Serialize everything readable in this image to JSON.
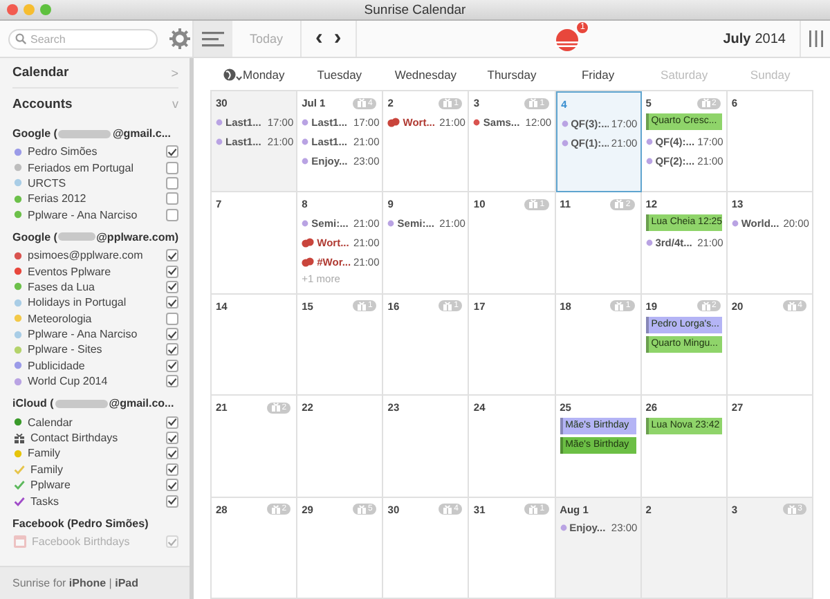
{
  "window": {
    "title": "Sunrise Calendar"
  },
  "toolbar": {
    "search": {
      "placeholder": "Search"
    },
    "today": "Today",
    "prev": "‹",
    "next": "›",
    "notification_count": "1",
    "month": "July",
    "year": "2014"
  },
  "sidebar": {
    "calendar_heading": "Calendar",
    "calendar_chevron": ">",
    "accounts_heading": "Accounts",
    "accounts_chevron": "v",
    "accounts": [
      {
        "prefix": "Google (",
        "suffix": "@gmail.c...",
        "items": [
          {
            "kind": "dot",
            "label": "Pedro Simões",
            "color": "#9b9be8",
            "checked": true
          },
          {
            "kind": "dot",
            "label": "Feriados em Portugal",
            "color": "#bdbdbd",
            "checked": false
          },
          {
            "kind": "dot",
            "label": "URCTS",
            "color": "#a9cde6",
            "checked": false
          },
          {
            "kind": "dot",
            "label": "Ferias 2012",
            "color": "#6cc04a",
            "checked": false
          },
          {
            "kind": "dot",
            "label": "Pplware - Ana Narciso",
            "color": "#6cc04a",
            "checked": false
          }
        ]
      },
      {
        "prefix": "Google (",
        "suffix": "@pplware.com)",
        "items": [
          {
            "kind": "dot",
            "label": "psimoes@pplware.com",
            "color": "#d9534f",
            "checked": true
          },
          {
            "kind": "dot",
            "label": "Eventos Pplware",
            "color": "#e8473c",
            "checked": true
          },
          {
            "kind": "dot",
            "label": "Fases da Lua",
            "color": "#6cc04a",
            "checked": true
          },
          {
            "kind": "dot",
            "label": "Holidays in Portugal",
            "color": "#a9cde6",
            "checked": true
          },
          {
            "kind": "dot",
            "label": "Meteorologia",
            "color": "#f3c948",
            "checked": false
          },
          {
            "kind": "dot",
            "label": "Pplware - Ana Narciso",
            "color": "#a9cde6",
            "checked": true
          },
          {
            "kind": "dot",
            "label": "Pplware - Sites",
            "color": "#b4d36b",
            "checked": true
          },
          {
            "kind": "dot",
            "label": "Publicidade",
            "color": "#9b9be8",
            "checked": true
          },
          {
            "kind": "dot",
            "label": "World Cup 2014",
            "color": "#b9a3e3",
            "checked": true
          }
        ]
      },
      {
        "prefix": "iCloud (",
        "suffix": "@gmail.co...",
        "items": [
          {
            "kind": "dot",
            "label": "Calendar",
            "color": "#3a9a2a",
            "checked": true
          },
          {
            "kind": "gift",
            "label": "Contact Birthdays",
            "checked": true
          },
          {
            "kind": "dot",
            "label": "Family",
            "color": "#e6c40a",
            "checked": true
          },
          {
            "kind": "tick",
            "label": "Family",
            "color": "#e6c44a",
            "checked": true
          },
          {
            "kind": "tick",
            "label": "Pplware",
            "color": "#5cb85c",
            "checked": true
          },
          {
            "kind": "tick",
            "label": "Tasks",
            "color": "#a04cc8",
            "checked": true
          }
        ]
      },
      {
        "title": "Facebook (Pedro Simões)",
        "items": [
          {
            "kind": "calendar",
            "label": "Facebook Birthdays",
            "checked": true,
            "disabled": true
          }
        ]
      }
    ],
    "footer": {
      "lead": "Sunrise for ",
      "first": "iPhone",
      "sep": " | ",
      "second": "iPad"
    }
  },
  "weekdays": [
    {
      "label": "Monday",
      "weekend": false
    },
    {
      "label": "Tuesday",
      "weekend": false
    },
    {
      "label": "Wednesday",
      "weekend": false
    },
    {
      "label": "Thursday",
      "weekend": false
    },
    {
      "label": "Friday",
      "weekend": false
    },
    {
      "label": "Saturday",
      "weekend": true
    },
    {
      "label": "Sunday",
      "weekend": true
    }
  ],
  "days": [
    {
      "label": "30",
      "outside": true,
      "selected": false,
      "events": [
        {
          "kind": "dot",
          "title": "Last1...",
          "time": "17:00",
          "color": "#b9a3e3"
        },
        {
          "kind": "dot",
          "title": "Last1...",
          "time": "21:00",
          "color": "#b9a3e3"
        }
      ]
    },
    {
      "label": "Jul 1",
      "outside": false,
      "selected": false,
      "badge": "4",
      "events": [
        {
          "kind": "dot",
          "title": "Last1...",
          "time": "17:00",
          "color": "#b9a3e3"
        },
        {
          "kind": "dot",
          "title": "Last1...",
          "time": "21:00",
          "color": "#b9a3e3"
        },
        {
          "kind": "dot",
          "title": "Enjoy...",
          "time": "23:00",
          "color": "#b9a3e3"
        }
      ]
    },
    {
      "label": "2",
      "outside": false,
      "selected": false,
      "badge": "1",
      "events": [
        {
          "kind": "social",
          "title": "Wort...",
          "time": "21:00",
          "color": "#c9453c"
        }
      ]
    },
    {
      "label": "3",
      "outside": false,
      "selected": false,
      "badge": "1",
      "events": [
        {
          "kind": "dot",
          "title": "Sams...",
          "time": "12:00",
          "color": "#d9534f"
        }
      ]
    },
    {
      "label": "4",
      "outside": false,
      "selected": true,
      "events": [
        {
          "kind": "dot",
          "title": "QF(3):...",
          "time": "17:00",
          "color": "#b9a3e3"
        },
        {
          "kind": "dot",
          "title": "QF(1):...",
          "time": "21:00",
          "color": "#b9a3e3"
        }
      ]
    },
    {
      "label": "5",
      "outside": false,
      "selected": false,
      "badge": "2",
      "events": [
        {
          "kind": "tile",
          "title": "Quarto Cresc...",
          "color": "#8fd46a"
        },
        {
          "kind": "dot",
          "title": "QF(4):...",
          "time": "17:00",
          "color": "#b9a3e3"
        },
        {
          "kind": "dot",
          "title": "QF(2):...",
          "time": "21:00",
          "color": "#b9a3e3"
        }
      ]
    },
    {
      "label": "6",
      "outside": false,
      "selected": false
    },
    {
      "label": "7",
      "outside": false,
      "selected": false
    },
    {
      "label": "8",
      "outside": false,
      "selected": false,
      "events": [
        {
          "kind": "dot",
          "title": "Semi:...",
          "time": "21:00",
          "color": "#b9a3e3"
        },
        {
          "kind": "social",
          "title": "Wort...",
          "time": "21:00",
          "color": "#c9453c"
        },
        {
          "kind": "social",
          "title": "#Wor...",
          "time": "21:00",
          "color": "#c9453c"
        }
      ],
      "more": "+1 more"
    },
    {
      "label": "9",
      "outside": false,
      "selected": false,
      "events": [
        {
          "kind": "dot",
          "title": "Semi:...",
          "time": "21:00",
          "color": "#b9a3e3"
        }
      ]
    },
    {
      "label": "10",
      "outside": false,
      "selected": false,
      "badge": "1"
    },
    {
      "label": "11",
      "outside": false,
      "selected": false,
      "badge": "2"
    },
    {
      "label": "12",
      "outside": false,
      "selected": false,
      "events": [
        {
          "kind": "tile",
          "title": "Lua Cheia 12:25",
          "color": "#8fd46a"
        },
        {
          "kind": "dot",
          "title": "3rd/4t...",
          "time": "21:00",
          "color": "#b9a3e3"
        }
      ]
    },
    {
      "label": "13",
      "outside": false,
      "selected": false,
      "events": [
        {
          "kind": "dot",
          "title": "World...",
          "time": "20:00",
          "color": "#b9a3e3"
        }
      ]
    },
    {
      "label": "14",
      "outside": false,
      "selected": false
    },
    {
      "label": "15",
      "outside": false,
      "selected": false,
      "badge": "1"
    },
    {
      "label": "16",
      "outside": false,
      "selected": false,
      "badge": "1"
    },
    {
      "label": "17",
      "outside": false,
      "selected": false
    },
    {
      "label": "18",
      "outside": false,
      "selected": false,
      "badge": "1"
    },
    {
      "label": "19",
      "outside": false,
      "selected": false,
      "badge": "2",
      "events": [
        {
          "kind": "tile",
          "title": "Pedro Lorga's...",
          "color": "#b4b4f5"
        },
        {
          "kind": "tile",
          "title": "Quarto Mingu...",
          "color": "#8fd46a"
        }
      ]
    },
    {
      "label": "20",
      "outside": false,
      "selected": false,
      "badge": "4"
    },
    {
      "label": "21",
      "outside": false,
      "selected": false,
      "badge": "2"
    },
    {
      "label": "22",
      "outside": false,
      "selected": false
    },
    {
      "label": "23",
      "outside": false,
      "selected": false
    },
    {
      "label": "24",
      "outside": false,
      "selected": false
    },
    {
      "label": "25",
      "outside": false,
      "selected": false,
      "events": [
        {
          "kind": "tile",
          "title": "Mãe's Birthday",
          "color": "#b4b4f5"
        },
        {
          "kind": "tile",
          "title": "Mãe's Birthday",
          "color": "#6cbf45"
        }
      ]
    },
    {
      "label": "26",
      "outside": false,
      "selected": false,
      "events": [
        {
          "kind": "tile",
          "title": "Lua Nova 23:42",
          "color": "#8fd46a"
        }
      ]
    },
    {
      "label": "27",
      "outside": false,
      "selected": false
    },
    {
      "label": "28",
      "outside": false,
      "selected": false,
      "badge": "2"
    },
    {
      "label": "29",
      "outside": false,
      "selected": false,
      "badge": "5"
    },
    {
      "label": "30",
      "outside": false,
      "selected": false,
      "badge": "4"
    },
    {
      "label": "31",
      "outside": false,
      "selected": false,
      "badge": "1"
    },
    {
      "label": "Aug 1",
      "outside": true,
      "selected": false,
      "events": [
        {
          "kind": "dot",
          "title": "Enjoy...",
          "time": "23:00",
          "color": "#b9a3e3"
        }
      ]
    },
    {
      "label": "2",
      "outside": true,
      "selected": false
    },
    {
      "label": "3",
      "outside": true,
      "selected": false,
      "badge": "3"
    }
  ]
}
